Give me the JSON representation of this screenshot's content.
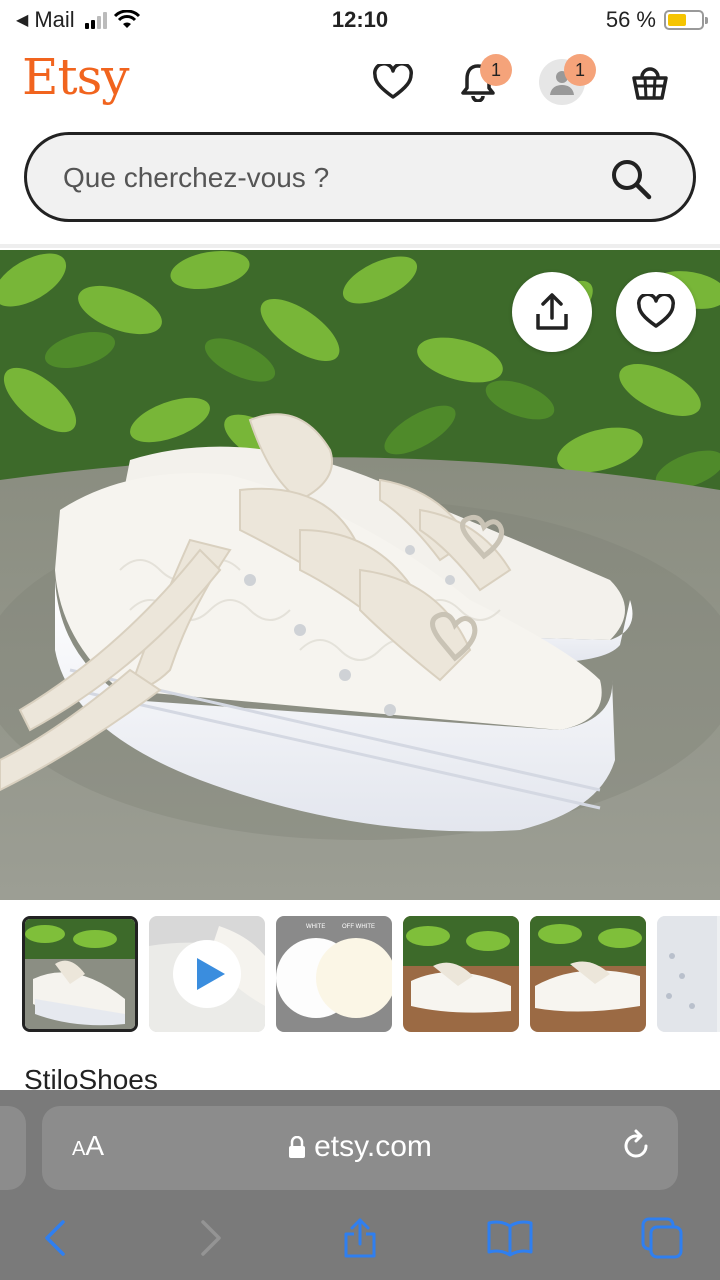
{
  "status_bar": {
    "carrier": "Mail",
    "time": "12:10",
    "battery": "56 %",
    "battery_level": 0.56
  },
  "header": {
    "logo": "Etsy",
    "notifications_count": "1",
    "account_count": "1",
    "icons": [
      "heart-icon",
      "bell-icon",
      "avatar-icon",
      "basket-icon"
    ]
  },
  "search": {
    "placeholder": "Que cherchez-vous ?"
  },
  "listing": {
    "shop_name": "StiloShoes",
    "thumbnails": [
      "photo",
      "video",
      "color-swatches",
      "photo",
      "photo",
      "photo"
    ],
    "swatch_labels": [
      "WHITE",
      "OFF WHITE"
    ]
  },
  "browser": {
    "text_size_label_small": "A",
    "text_size_label_large": "A",
    "url": "etsy.com"
  },
  "colors": {
    "brand": "#f1641e",
    "badge": "#f5a37a",
    "safari_blue": "#2f7ff0"
  }
}
